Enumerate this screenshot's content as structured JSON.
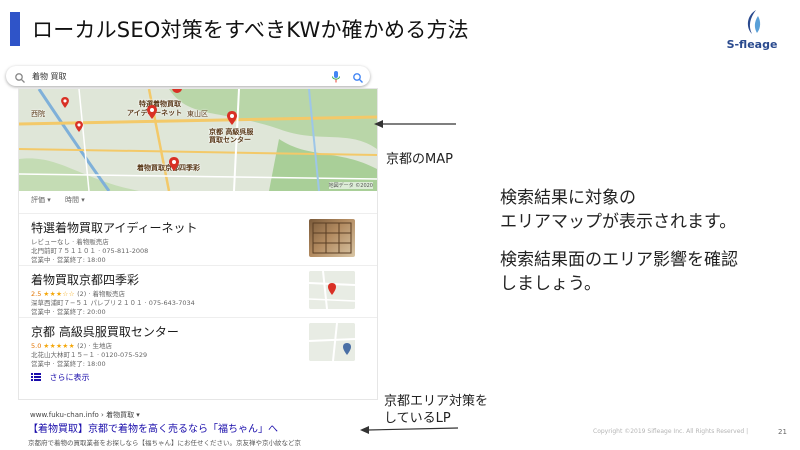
{
  "slide": {
    "title": "ローカルSEO対策をすべきKWか確かめる方法",
    "logo_text": "S-fleage",
    "page_number": "21",
    "copyright": "Copyright ©2019 Sifleage Inc. All Rights Reserved |",
    "accent_color": "#2f54c8"
  },
  "search": {
    "query": "着物 買取",
    "icons": [
      "search-icon",
      "microphone-icon",
      "search-button-icon"
    ]
  },
  "map": {
    "labels": [
      "特選着物買取",
      "アイディーネット",
      "京都 高級呉服",
      "買取センター",
      "着物買取京都四季彩",
      "東山区",
      "西院"
    ],
    "credit": "地図データ ©2020"
  },
  "filters": [
    "評価 ▾",
    "時間 ▾"
  ],
  "listings": [
    {
      "name": "特選着物買取アイディーネット",
      "meta": "レビューなし · 着物販売店",
      "address": "北門前町７５１１０１ · 075-811-2008",
      "hours": "営業中 · 営業終了: 18:00",
      "thumb": "photo"
    },
    {
      "name": "着物買取京都四季彩",
      "rating": "2.5",
      "stars": "★★★☆☆",
      "meta": "(2) · 着物販売店",
      "address": "深草西浦町７−５１ パレプリ２１０１ · 075-643-7034",
      "hours": "営業中 · 営業終了: 20:00",
      "thumb": "map"
    },
    {
      "name": "京都 高級呉服買取センター",
      "rating": "5.0",
      "stars": "★★★★★",
      "meta": "(2) · 生地店",
      "address": "北花山大林町１５−１ · 0120-075-529",
      "hours": "営業中 · 営業終了: 18:00",
      "thumb": "map"
    }
  ],
  "more_label": "さらに表示",
  "organic": {
    "url": "www.fuku-chan.info › 着物買取 ▾",
    "title": "【着物買取】京都で着物を高く売るなら「福ちゃん」へ",
    "snippet": "京都府で着物の買取業者をお探しなら【福ちゃん】にお任せください。京友禅や京小紋など京"
  },
  "annotations": {
    "map_caption": "京都のMAP",
    "desc_line1": "検索結果に対象の",
    "desc_line2": "エリアマップが表示されます。",
    "desc_line3": "検索結果面のエリア影響を確認",
    "desc_line4": "しましょう。",
    "lp_line1": "京都エリア対策を",
    "lp_line2": "しているLP"
  }
}
